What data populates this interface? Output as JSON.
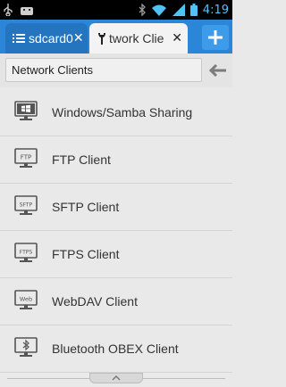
{
  "status_bar": {
    "time": "4:19",
    "icons": [
      "usb-icon",
      "android-icon",
      "bluetooth-icon",
      "wifi-icon",
      "signal-icon",
      "battery-icon"
    ]
  },
  "tabs": [
    {
      "label": "sdcard0",
      "icon": "list-icon",
      "active": false
    },
    {
      "label": "twork Clie",
      "icon": "wrench-icon",
      "active": true
    }
  ],
  "add_button": {
    "icon": "plus-icon"
  },
  "path_bar": {
    "value": "Network Clients",
    "back_icon": "back-arrow-icon"
  },
  "items": [
    {
      "label": "Windows/Samba Sharing",
      "icon_text": ""
    },
    {
      "label": "FTP Client",
      "icon_text": "FTP"
    },
    {
      "label": "SFTP Client",
      "icon_text": "SFTP"
    },
    {
      "label": "FTPS Client",
      "icon_text": "FTPS"
    },
    {
      "label": "WebDAV Client",
      "icon_text": "Web"
    },
    {
      "label": "Bluetooth OBEX Client",
      "icon_text": ""
    }
  ],
  "colors": {
    "tab_bar": "#2c86d8",
    "active_tab": "#f3f3f3",
    "background": "#e9e9e9",
    "time": "#4fc3f7"
  }
}
